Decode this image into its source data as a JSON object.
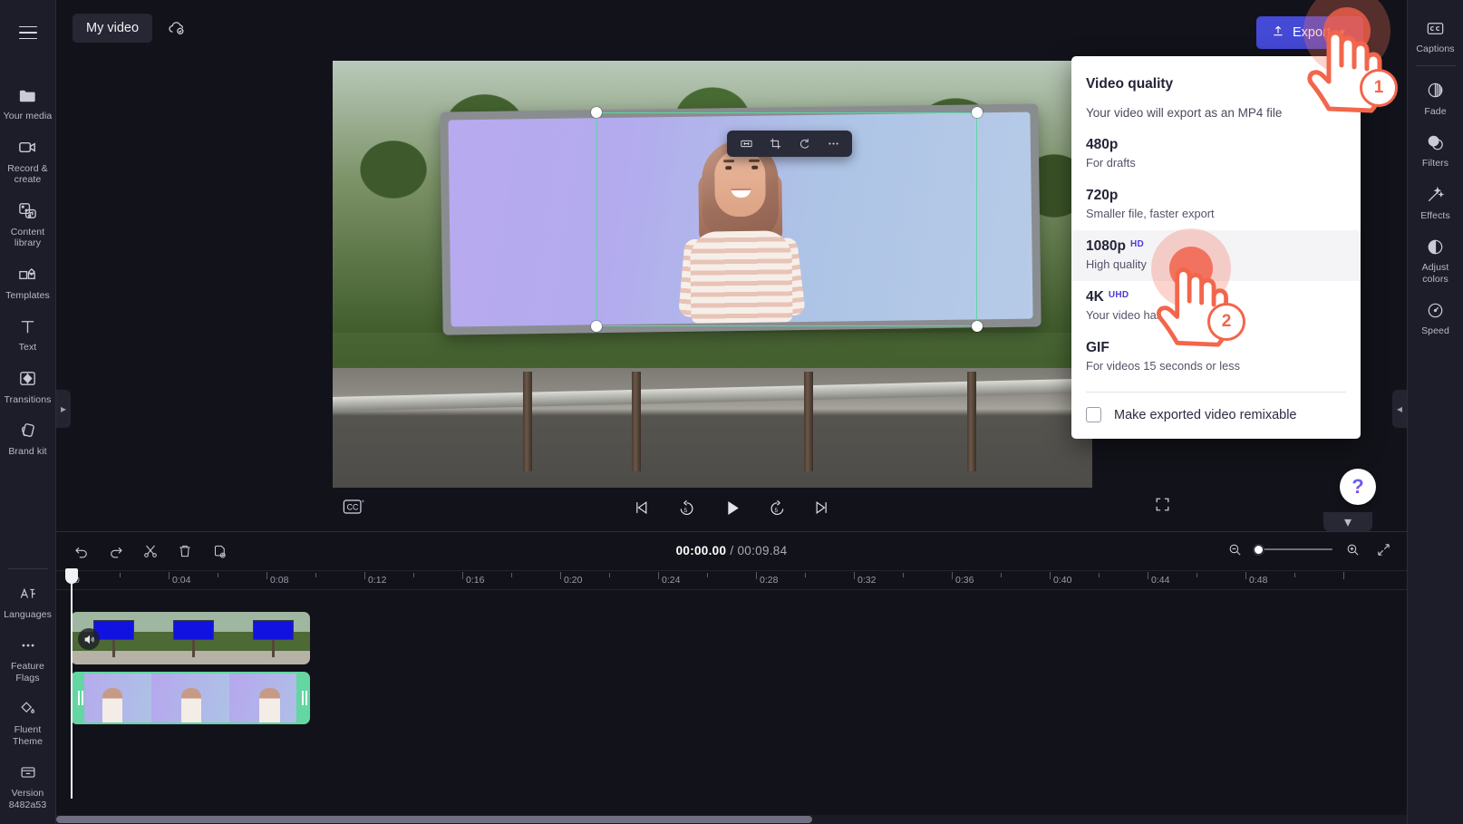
{
  "app": {
    "project_name": "My video",
    "cloud_status_icon": "cloud-saved-icon"
  },
  "topbar": {
    "export_label": "Export",
    "export_icon": "upload-arrow-icon",
    "export_chevron": "chevron-down-icon",
    "menu_icon": "hamburger-menu-icon"
  },
  "left_rail": {
    "items": [
      {
        "label": "Your media",
        "icon": "folder-icon"
      },
      {
        "label": "Record & create",
        "icon": "video-camera-icon"
      },
      {
        "label": "Content library",
        "icon": "content-library-icon"
      },
      {
        "label": "Templates",
        "icon": "templates-icon"
      },
      {
        "label": "Text",
        "icon": "text-icon"
      },
      {
        "label": "Transitions",
        "icon": "transitions-icon"
      },
      {
        "label": "Brand kit",
        "icon": "brand-kit-icon"
      }
    ],
    "bottom_items": [
      {
        "label": "Languages",
        "icon": "language-icon"
      },
      {
        "label": "Feature Flags",
        "icon": "ellipsis-icon"
      },
      {
        "label": "Fluent Theme",
        "icon": "theme-droplet-icon"
      },
      {
        "label": "Version 8482a53",
        "icon": "archive-box-icon"
      }
    ]
  },
  "right_rail": {
    "items": [
      {
        "label": "Captions",
        "icon": "closed-captions-icon"
      },
      {
        "label": "Fade",
        "icon": "fade-icon"
      },
      {
        "label": "Filters",
        "icon": "filters-icon"
      },
      {
        "label": "Effects",
        "icon": "effects-wand-icon"
      },
      {
        "label": "Adjust colors",
        "icon": "adjust-colors-icon"
      },
      {
        "label": "Speed",
        "icon": "speed-gauge-icon"
      }
    ]
  },
  "canvas_toolbar": {
    "buttons": [
      {
        "name": "fit-to-width",
        "icon": "fit-width-icon"
      },
      {
        "name": "crop",
        "icon": "crop-icon"
      },
      {
        "name": "rotate",
        "icon": "rotate-icon"
      },
      {
        "name": "more-options",
        "icon": "ellipsis-icon"
      }
    ]
  },
  "player": {
    "captions_button_icon": "cc-sparkle-icon",
    "skip_back_icon": "skip-to-start-icon",
    "back_5_icon": "rewind-5-icon",
    "play_icon": "play-icon",
    "forward_5_icon": "forward-5-icon",
    "skip_forward_icon": "skip-to-end-icon",
    "fullscreen_icon": "fullscreen-icon"
  },
  "help": {
    "icon_label": "?",
    "collapse_icon": "chevron-down-icon"
  },
  "timeline": {
    "tools": [
      {
        "name": "undo",
        "icon": "undo-icon"
      },
      {
        "name": "redo",
        "icon": "redo-icon"
      },
      {
        "name": "split",
        "icon": "scissors-icon"
      },
      {
        "name": "delete",
        "icon": "trash-icon"
      },
      {
        "name": "duplicate",
        "icon": "duplicate-icon"
      }
    ],
    "current_time": "00:00.00",
    "separator": "/",
    "total_time": "00:09.84",
    "zoom_out_icon": "zoom-out-icon",
    "zoom_in_icon": "zoom-in-icon",
    "fit_icon": "fit-timeline-icon",
    "zoom_value": 0,
    "ruler_labels": [
      "0",
      "0:04",
      "0:08",
      "0:12",
      "0:16",
      "0:20",
      "0:24",
      "0:28",
      "0:32",
      "0:36",
      "0:40",
      "0:44",
      "0:48"
    ],
    "tracks": [
      {
        "name": "billboard-video-track",
        "muted": true,
        "mute_icon": "speaker-icon"
      },
      {
        "name": "presenter-video-track",
        "selected": true
      }
    ]
  },
  "export_dropdown": {
    "title": "Video quality",
    "subtitle": "Your video will export as an MP4 file",
    "options": [
      {
        "label": "480p",
        "badge": "",
        "description": "For drafts",
        "selected": false
      },
      {
        "label": "720p",
        "badge": "",
        "description": "Smaller file, faster export",
        "selected": false
      },
      {
        "label": "1080p",
        "badge": "HD",
        "description": "High quality",
        "selected": true
      },
      {
        "label": "4K",
        "badge": "UHD",
        "description": "Your video has no 4K media",
        "selected": false
      },
      {
        "label": "GIF",
        "badge": "",
        "description": "For videos 15 seconds or less",
        "selected": false
      }
    ],
    "remixable_label": "Make exported video remixable",
    "remixable_checked": false
  },
  "annotations": [
    {
      "step": "1",
      "target": "export-button"
    },
    {
      "step": "2",
      "target": "1080p-option"
    }
  ],
  "colors": {
    "accent_purple": "#4449d6",
    "annotation_orange": "#f2664b",
    "selection_green": "#63d6a2",
    "badge_blue": "#4b3bd8"
  }
}
